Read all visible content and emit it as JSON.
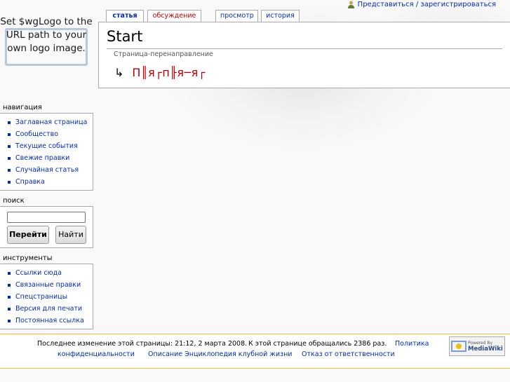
{
  "personal_tools": {
    "login_label": "Представиться / зарегистрироваться"
  },
  "logo": {
    "text": "Set $wgLogo to the URL path to your own logo image."
  },
  "tabs": [
    {
      "label": "статья"
    },
    {
      "label": "обсуждение"
    },
    {
      "label": "просмотр"
    },
    {
      "label": "история"
    }
  ],
  "content": {
    "title": "Start",
    "subtitle": "Страница-перенаправление",
    "redirect_arrow": "↳",
    "redirect_target": "П║я┌п╟я─я┌"
  },
  "navigation": {
    "heading": "навигация",
    "items": [
      {
        "label": "Заглавная страница"
      },
      {
        "label": "Сообщество"
      },
      {
        "label": "Текущие события"
      },
      {
        "label": "Свежие правки"
      },
      {
        "label": "Случайная статья"
      },
      {
        "label": "Справка"
      }
    ]
  },
  "search": {
    "heading": "поиск",
    "value": "",
    "go_label": "Перейти",
    "find_label": "Найти"
  },
  "tools": {
    "heading": "инструменты",
    "items": [
      {
        "label": "Ссылки сюда"
      },
      {
        "label": "Связанные правки"
      },
      {
        "label": "Спецстраницы"
      },
      {
        "label": "Версия для печати"
      },
      {
        "label": "Постоянная ссылка"
      }
    ]
  },
  "footer": {
    "last_modified": "Последнее изменение этой страницы: 21:12, 2 марта 2008.",
    "views": "К этой странице обращались 2386 раз.",
    "privacy_line1": "Политика",
    "privacy_line2": "конфиденциальности",
    "about": "Описание Энциклопедия клубной жизни",
    "disclaimer": "Отказ от ответственности",
    "powered_small": "Powered By",
    "powered_big": "MediaWiki"
  },
  "colors": {
    "link": "#002bb8",
    "new_link": "#ba0000",
    "footer_border": "#fabd23"
  }
}
